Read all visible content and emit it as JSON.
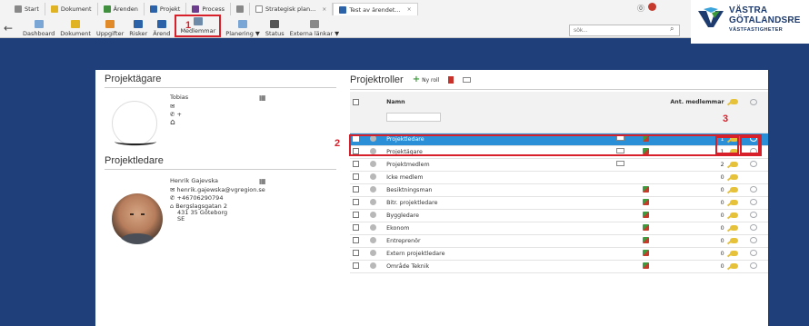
{
  "tabs": [
    {
      "label": "Start",
      "icon": "home-icon"
    },
    {
      "label": "Dokument",
      "icon": "document-icon"
    },
    {
      "label": "Ärenden",
      "icon": "cases-icon"
    },
    {
      "label": "Projekt",
      "icon": "project-icon"
    },
    {
      "label": "Process",
      "icon": "process-icon"
    },
    {
      "label": "",
      "icon": "link-icon"
    },
    {
      "label": "Strategisk plan...",
      "icon": "page-icon"
    },
    {
      "label": "Test av ärendet...",
      "icon": "grid-icon"
    }
  ],
  "toolbar": {
    "items": [
      "Dashboard",
      "Dokument",
      "Uppgifter",
      "Risker",
      "Ärend",
      "Medlemmar",
      "Planering ▼",
      "Status",
      "Externa länkar ▼"
    ],
    "search_placeholder": "sök..."
  },
  "logo": {
    "line1": "VÄSTRA",
    "line2": "GÖTALANDSRE",
    "line3": "VÄSTFASTIGHETER"
  },
  "annotations": [
    "1",
    "2",
    "3"
  ],
  "owner": {
    "heading": "Projektägare",
    "name": "Tobias",
    "phone": "+"
  },
  "leader": {
    "heading": "Projektledare",
    "name": "Henrik Gajevska",
    "email": "henrik.gajewska@vgregion.se",
    "phone": "+46706290794",
    "street": "Bergslagsgatan 2",
    "city": "431 35 Göteborg",
    "country": "SE"
  },
  "roles": {
    "heading": "Projektroller",
    "new_role": "Ny roll",
    "col_name": "Namn",
    "col_members": "Ant. medlemmar",
    "rows": [
      {
        "name": "Projektledare",
        "count": "1"
      },
      {
        "name": "Projektägare",
        "count": "1"
      },
      {
        "name": "Projektmedlem",
        "count": "2"
      },
      {
        "name": "Icke medlem",
        "count": "0"
      },
      {
        "name": "Besiktningsman",
        "count": "0"
      },
      {
        "name": "Bitr. projektledare",
        "count": "0"
      },
      {
        "name": "Byggledare",
        "count": "0"
      },
      {
        "name": "Ekonom",
        "count": "0"
      },
      {
        "name": "Entreprenör",
        "count": "0"
      },
      {
        "name": "Extern projektledare",
        "count": "0"
      },
      {
        "name": "Område Teknik",
        "count": "0"
      }
    ]
  }
}
